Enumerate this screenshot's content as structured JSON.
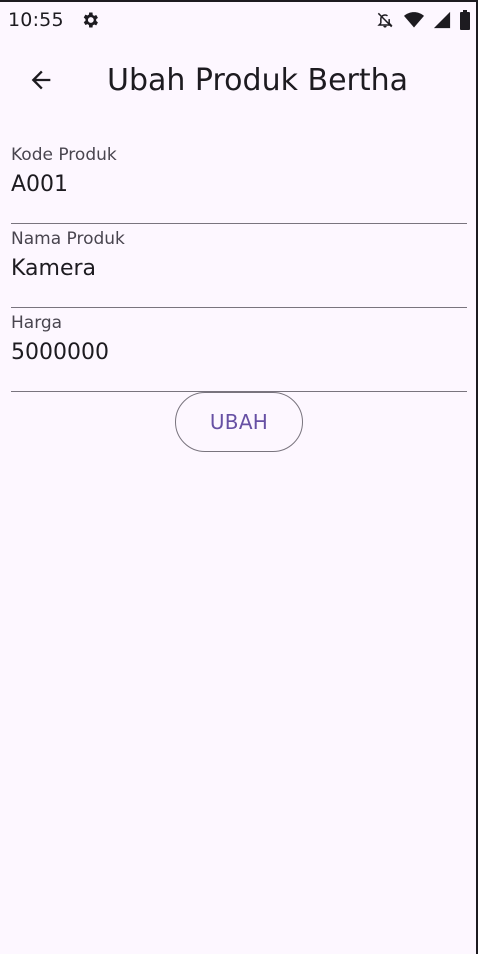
{
  "status_bar": {
    "time": "10:55",
    "icons": [
      "settings-gear-icon",
      "notifications-off-icon",
      "wifi-icon",
      "cell-signal-icon",
      "battery-icon"
    ]
  },
  "app_bar": {
    "title": "Ubah Produk Bertha",
    "back_icon": "arrow-back-icon"
  },
  "form": {
    "kode": {
      "label": "Kode Produk",
      "value": "A001"
    },
    "nama": {
      "label": "Nama Produk",
      "value": "Kamera"
    },
    "harga": {
      "label": "Harga",
      "value": "5000000"
    }
  },
  "submit_label": "UBAH",
  "colors": {
    "background": "#fdf7ff",
    "accent": "#6750a4",
    "text": "#1d1b20",
    "outline": "#79747e"
  }
}
